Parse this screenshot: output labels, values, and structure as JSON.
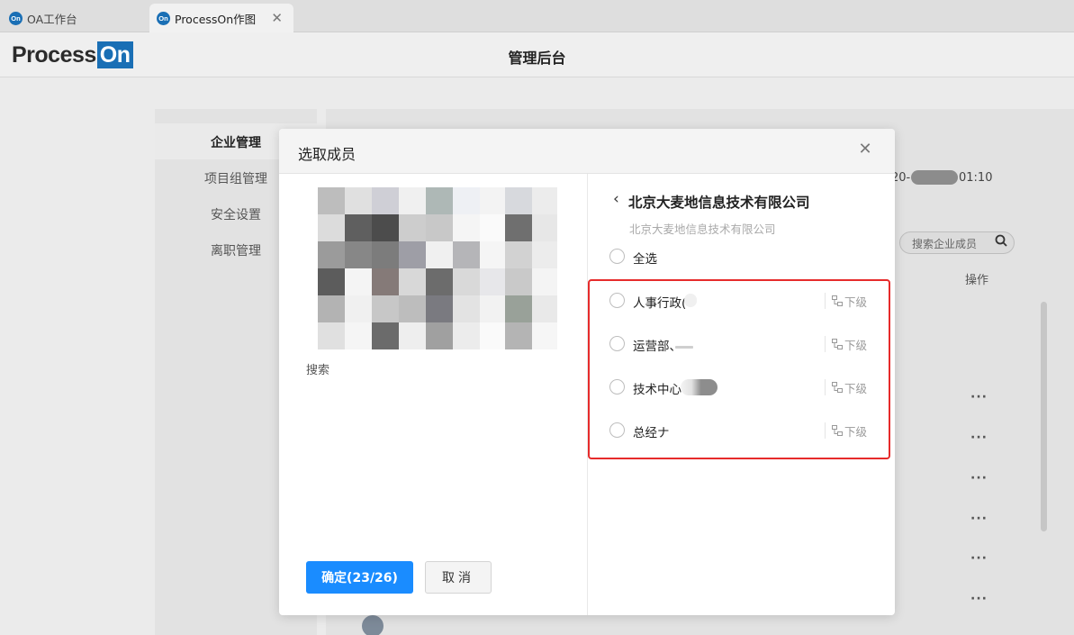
{
  "browser": {
    "tabs": [
      {
        "label": "OA工作台",
        "icon": "On"
      },
      {
        "label": "ProcessOn作图",
        "icon": "On",
        "close": "✕"
      }
    ]
  },
  "header": {
    "logo_text": "Process",
    "logo_badge": "On",
    "title": "管理后台"
  },
  "sidebar": {
    "items": [
      {
        "label": "企业管理"
      },
      {
        "label": "项目组管理"
      },
      {
        "label": "安全设置"
      },
      {
        "label": "离职管理"
      }
    ]
  },
  "background": {
    "date_prefix": "20-",
    "date_suffix": "01:10",
    "search_placeholder": "搜索企业成员",
    "op_header": "操作",
    "more": "···"
  },
  "modal": {
    "title": "选取成员",
    "close": "✕",
    "search_label": "搜索",
    "confirm": "确定(23/26)",
    "cancel": "取消",
    "back": "‹",
    "company_name": "北京大麦地信息技术有限公司",
    "breadcrumb": "北京大麦地信息技术有限公司",
    "select_all": "全选",
    "departments": [
      {
        "name": "人事行政(",
        "sub": "下级"
      },
      {
        "name": "运营部、",
        "sub": "下级"
      },
      {
        "name": "技术中心",
        "sub": "下级"
      },
      {
        "name": "总经ナ",
        "sub": "下级"
      }
    ]
  },
  "colors": {
    "primary": "#1a8cff",
    "highlight_border": "#e62b2b",
    "brand": "#1a6fb5"
  }
}
